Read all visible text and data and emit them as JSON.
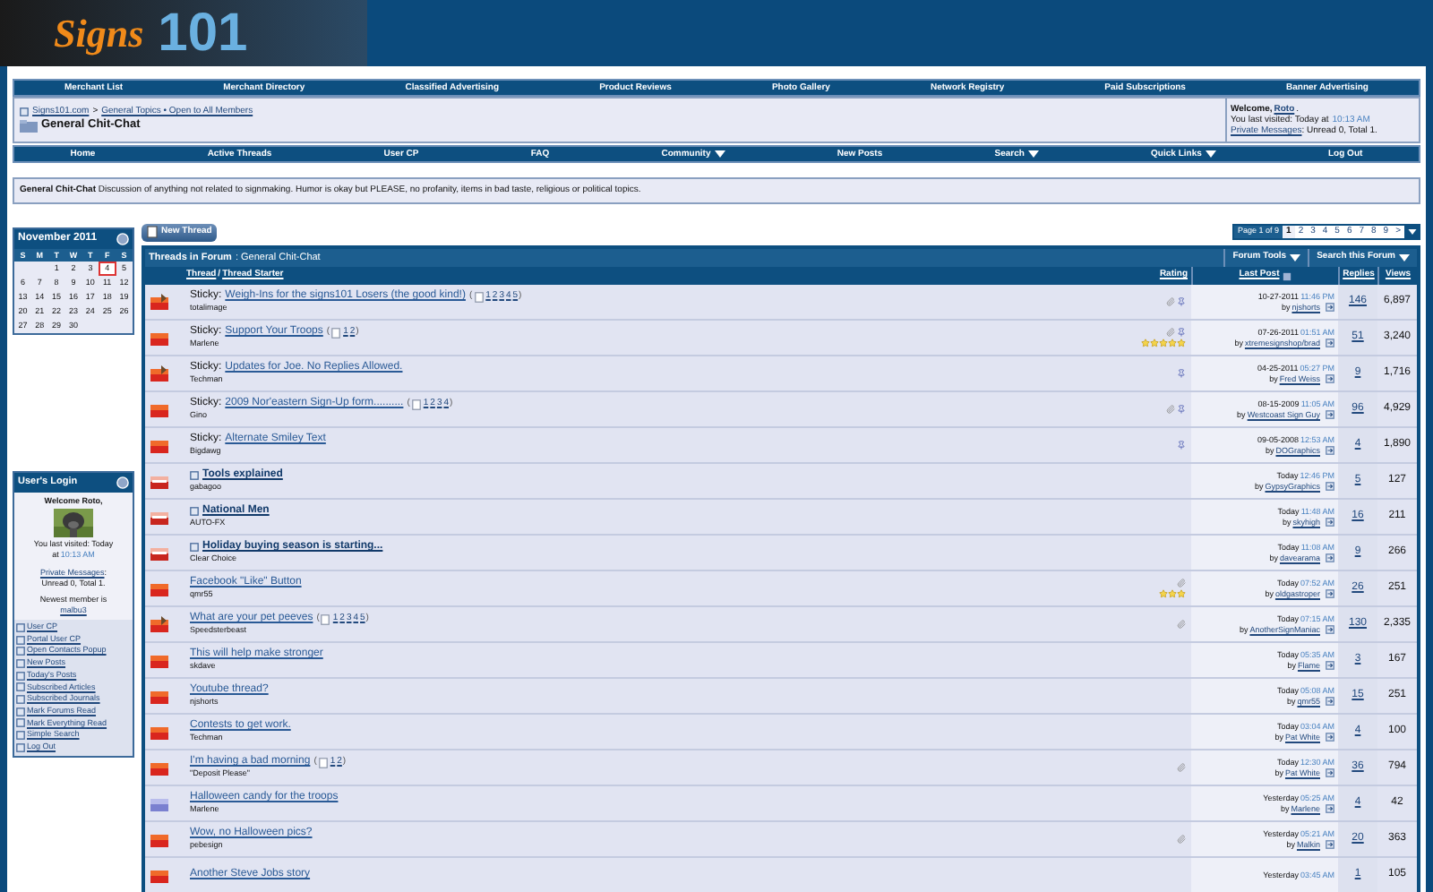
{
  "logo": {
    "script": "Signs",
    "number": "101"
  },
  "top_nav": [
    {
      "label": "Merchant List"
    },
    {
      "label": "Merchant Directory"
    },
    {
      "label": "Classified Advertising"
    },
    {
      "label": "Product Reviews"
    },
    {
      "label": "Photo Gallery"
    },
    {
      "label": "Network Registry"
    },
    {
      "label": "Paid Subscriptions"
    },
    {
      "label": "Banner Advertising"
    }
  ],
  "breadcrumb": {
    "links": [
      "Signs101.com",
      "General Topics • Open to All Members"
    ],
    "separator": ">",
    "title": "General Chit-Chat"
  },
  "welcome": {
    "greeting": "Welcome,",
    "user": "Roto",
    "period": ".",
    "visited": "You last visited: Today at",
    "time": "10:13 AM",
    "pm_link": "Private Messages",
    "pm_text": ": Unread 0, Total 1."
  },
  "main_nav": [
    {
      "label": "Home",
      "dropdown": false
    },
    {
      "label": "Active Threads",
      "dropdown": false
    },
    {
      "label": "User CP",
      "dropdown": false
    },
    {
      "label": "FAQ",
      "dropdown": false
    },
    {
      "label": "Community",
      "dropdown": true
    },
    {
      "label": "New Posts",
      "dropdown": false
    },
    {
      "label": "Search",
      "dropdown": true
    },
    {
      "label": "Quick Links",
      "dropdown": true
    },
    {
      "label": "Log Out",
      "dropdown": false
    }
  ],
  "forum_description": "**General Chit-Chat** Discussion of anything not related to signmaking. Humor is okay but PLEASE, no profanity, items in bad taste, religious or political topics.",
  "calendar": {
    "title": "November 2011",
    "weekdays": [
      "S",
      "M",
      "T",
      "W",
      "T",
      "F",
      "S"
    ],
    "weeks": [
      {
        "kind": "first",
        "days": [
          {
            "day": "1",
            "selected": false
          },
          {
            "day": "2",
            "selected": false
          },
          {
            "day": "3",
            "selected": false
          },
          {
            "day": "4",
            "selected": true
          },
          {
            "day": "5",
            "selected": false
          }
        ]
      },
      {
        "kind": "full",
        "days": [
          {
            "day": "6",
            "selected": false
          },
          {
            "day": "7",
            "selected": false
          },
          {
            "day": "8",
            "selected": false
          },
          {
            "day": "9",
            "selected": false
          },
          {
            "day": "10",
            "selected": false
          },
          {
            "day": "11",
            "selected": false
          },
          {
            "day": "12",
            "selected": false
          }
        ]
      },
      {
        "kind": "full",
        "days": [
          {
            "day": "13",
            "selected": false
          },
          {
            "day": "14",
            "selected": false
          },
          {
            "day": "15",
            "selected": false
          },
          {
            "day": "16",
            "selected": false
          },
          {
            "day": "17",
            "selected": false
          },
          {
            "day": "18",
            "selected": false
          },
          {
            "day": "19",
            "selected": false
          }
        ]
      },
      {
        "kind": "full",
        "days": [
          {
            "day": "20",
            "selected": false
          },
          {
            "day": "21",
            "selected": false
          },
          {
            "day": "22",
            "selected": false
          },
          {
            "day": "23",
            "selected": false
          },
          {
            "day": "24",
            "selected": false
          },
          {
            "day": "25",
            "selected": false
          },
          {
            "day": "26",
            "selected": false
          }
        ]
      },
      {
        "kind": "last",
        "days": [
          {
            "day": "27",
            "selected": false
          },
          {
            "day": "28",
            "selected": false
          },
          {
            "day": "29",
            "selected": false
          },
          {
            "day": "30",
            "selected": false
          }
        ]
      }
    ]
  },
  "user_login": {
    "title": "User's Login",
    "welcome": "Welcome Roto,",
    "visited": "You last visited: Today",
    "time_prefix": "at",
    "time": "10:13 AM",
    "pm_link": "Private Messages",
    "pm_colon": ":",
    "pm_text": "Unread 0, Total 1.",
    "newest": "Newest member is",
    "newest_user": "malbu3",
    "links": [
      "User CP",
      "Portal User CP",
      "Open Contacts Popup",
      "New Posts",
      "Today's Posts",
      "Subscribed Articles",
      "Subscribed Journals",
      "Mark Forums Read",
      "Mark Everything Read",
      "Simple Search",
      "Log Out"
    ]
  },
  "new_thread_button": "New Thread",
  "pagination": {
    "label": "Page 1 of 9",
    "pages": [
      {
        "label": "1",
        "selected": true
      },
      {
        "label": "2",
        "selected": false
      },
      {
        "label": "3",
        "selected": false
      },
      {
        "label": "4",
        "selected": false
      },
      {
        "label": "5",
        "selected": false
      },
      {
        "label": "6",
        "selected": false
      },
      {
        "label": "7",
        "selected": false
      },
      {
        "label": "8",
        "selected": false
      },
      {
        "label": "9",
        "selected": false
      }
    ],
    "next": ">"
  },
  "threads": {
    "title": "Threads in Forum",
    "subtitle": ": General Chit-Chat",
    "tools": [
      {
        "label": "Forum Tools"
      },
      {
        "label": "Search this Forum"
      }
    ],
    "columns": {
      "thread": "Thread",
      "slash": "/",
      "starter": "Thread Starter",
      "rating": "Rating",
      "last_post": "Last Post",
      "replies": "Replies",
      "views": "Views"
    },
    "rows": [
      {
        "kind": "posted",
        "prefix": "Sticky:",
        "title": "Weigh-Ins for the signs101 Losers (the good kind!)",
        "unread": false,
        "pages": {
          "open": "(",
          "links": [
            "1",
            "2",
            "3",
            "4",
            "5"
          ],
          "close": ")"
        },
        "starter": "totalimage",
        "attachment": true,
        "pinned": true,
        "date": "10-27-2011",
        "time": "11:46 PM",
        "by": "by",
        "user": "njshorts",
        "replies": "146",
        "views": "6,897"
      },
      {
        "kind": "hot",
        "prefix": "Sticky:",
        "title": "Support Your Troops",
        "unread": false,
        "pages": {
          "open": "(",
          "links": [
            "1",
            "2"
          ],
          "close": ")"
        },
        "starter": "Marlene",
        "attachment": true,
        "pinned": true,
        "stars": 5,
        "date": "07-26-2011",
        "time": "01:51 AM",
        "by": "by",
        "user": "xtremesignshop/brad",
        "replies": "51",
        "views": "3,240"
      },
      {
        "kind": "posted",
        "prefix": "Sticky:",
        "title": "Updates for Joe. No Replies Allowed.",
        "unread": false,
        "starter": "Techman",
        "pinned": true,
        "date": "04-25-2011",
        "time": "05:27 PM",
        "by": "by",
        "user": "Fred Weiss",
        "replies": "9",
        "views": "1,716"
      },
      {
        "kind": "hot",
        "prefix": "Sticky:",
        "title": "2009 Nor'eastern Sign-Up form..........",
        "unread": false,
        "pages": {
          "open": "(",
          "links": [
            "1",
            "2",
            "3",
            "4"
          ],
          "close": ")"
        },
        "starter": "Gino",
        "attachment": true,
        "pinned": true,
        "date": "08-15-2009",
        "time": "11:05 AM",
        "by": "by",
        "user": "Westcoast Sign Guy",
        "replies": "96",
        "views": "4,929"
      },
      {
        "kind": "hot",
        "prefix": "Sticky:",
        "title": "Alternate Smiley Text",
        "unread": false,
        "starter": "Bigdawg",
        "pinned": true,
        "date": "09-05-2008",
        "time": "12:53 AM",
        "by": "by",
        "user": "DOGraphics",
        "replies": "4",
        "views": "1,890"
      },
      {
        "kind": "new",
        "title": "Tools explained",
        "unread": true,
        "post_icon": true,
        "starter": "gabagoo",
        "date": "Today",
        "time": "12:46 PM",
        "by": "by",
        "user": "GypsyGraphics",
        "replies": "5",
        "views": "127"
      },
      {
        "kind": "new",
        "title": "National Men",
        "unread": true,
        "post_icon": true,
        "starter": "AUTO-FX",
        "date": "Today",
        "time": "11:48 AM",
        "by": "by",
        "user": "skyhigh",
        "replies": "16",
        "views": "211"
      },
      {
        "kind": "new",
        "title": "Holiday buying season is starting...",
        "unread": true,
        "post_icon": true,
        "starter": "Clear Choice",
        "date": "Today",
        "time": "11:08 AM",
        "by": "by",
        "user": "davearama",
        "replies": "9",
        "views": "266"
      },
      {
        "kind": "hot",
        "title": "Facebook \"Like\" Button",
        "unread": false,
        "starter": "qmr55",
        "attachment": true,
        "stars": 3,
        "date": "Today",
        "time": "07:52 AM",
        "by": "by",
        "user": "oldgastroper",
        "replies": "26",
        "views": "251"
      },
      {
        "kind": "posted",
        "title": "What are your pet peeves",
        "unread": false,
        "pages": {
          "open": "(",
          "links": [
            "1",
            "2",
            "3",
            "4",
            "5"
          ],
          "close": ")"
        },
        "starter": "Speedsterbeast",
        "attachment": true,
        "date": "Today",
        "time": "07:15 AM",
        "by": "by",
        "user": "AnotherSignManiac",
        "replies": "130",
        "views": "2,335"
      },
      {
        "kind": "hot",
        "title": "This will help make stronger",
        "unread": false,
        "starter": "skdave",
        "date": "Today",
        "time": "05:35 AM",
        "by": "by",
        "user": "Flame",
        "replies": "3",
        "views": "167"
      },
      {
        "kind": "hot",
        "title": "Youtube thread?",
        "unread": false,
        "starter": "njshorts",
        "date": "Today",
        "time": "05:08 AM",
        "by": "by",
        "user": "qmr55",
        "replies": "15",
        "views": "251"
      },
      {
        "kind": "hot",
        "title": "Contests to get work.",
        "unread": false,
        "starter": "Techman",
        "date": "Today",
        "time": "03:04 AM",
        "by": "by",
        "user": "Pat White",
        "replies": "4",
        "views": "100"
      },
      {
        "kind": "hot",
        "title": "I'm having a bad morning",
        "unread": false,
        "pages": {
          "open": "(",
          "links": [
            "1",
            "2"
          ],
          "close": ")"
        },
        "starter": "\"Deposit Please\"",
        "attachment": true,
        "date": "Today",
        "time": "12:30 AM",
        "by": "by",
        "user": "Pat White",
        "replies": "36",
        "views": "794"
      },
      {
        "kind": "old",
        "title": "Halloween candy for the troops",
        "unread": false,
        "starter": "Marlene",
        "date": "Yesterday",
        "time": "05:25 AM",
        "by": "by",
        "user": "Marlene",
        "replies": "4",
        "views": "42"
      },
      {
        "kind": "hot",
        "title": "Wow, no Halloween pics?",
        "unread": false,
        "starter": "pebesign",
        "attachment": true,
        "date": "Yesterday",
        "time": "05:21 AM",
        "by": "by",
        "user": "Malkin",
        "replies": "20",
        "views": "363"
      },
      {
        "kind": "hot",
        "title": "Another Steve Jobs story",
        "unread": false,
        "date": "Yesterday",
        "time": "03:45 AM",
        "replies": "1",
        "views": "105"
      }
    ]
  }
}
